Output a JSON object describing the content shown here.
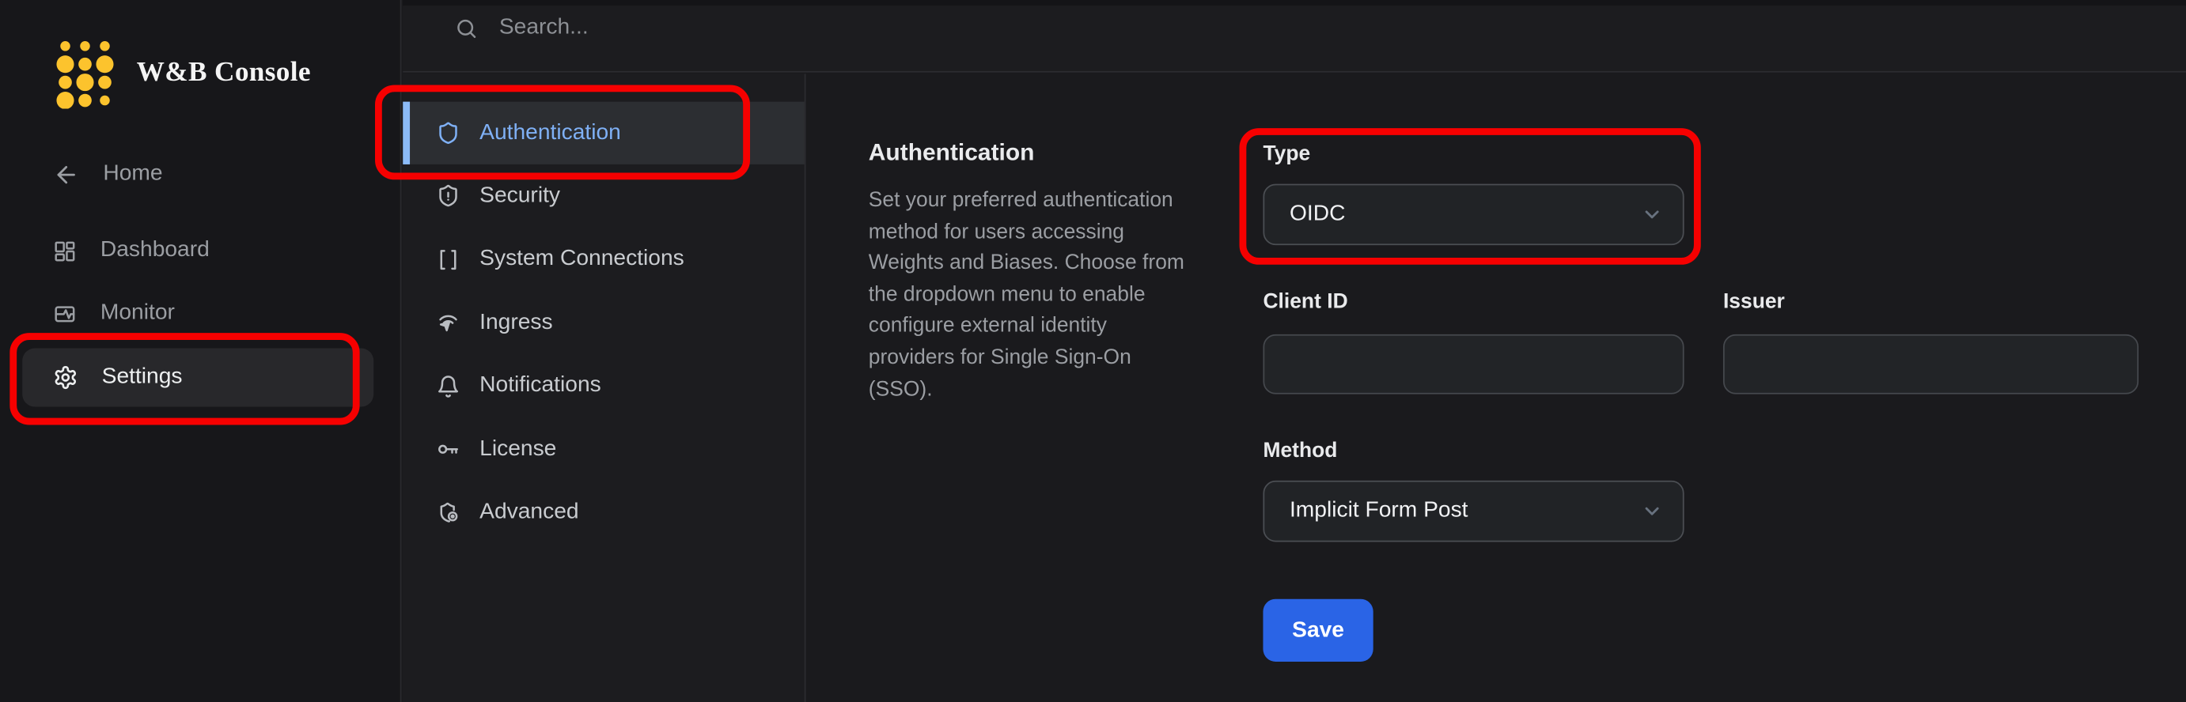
{
  "app": {
    "title": "W&B Console"
  },
  "search": {
    "placeholder": "Search..."
  },
  "left_sidebar": {
    "items": [
      {
        "label": "Home",
        "icon": "arrow-left-icon"
      },
      {
        "label": "Dashboard",
        "icon": "dashboard-icon"
      },
      {
        "label": "Monitor",
        "icon": "monitor-icon"
      },
      {
        "label": "Settings",
        "icon": "gear-icon",
        "active": true
      }
    ]
  },
  "settings_nav": {
    "items": [
      {
        "label": "Authentication",
        "icon": "shield-icon",
        "active": true
      },
      {
        "label": "Security",
        "icon": "shield-alert-icon",
        "active": false
      },
      {
        "label": "System Connections",
        "icon": "brackets-icon",
        "active": false
      },
      {
        "label": "Ingress",
        "icon": "ingress-icon",
        "active": false
      },
      {
        "label": "Notifications",
        "icon": "bell-icon",
        "active": false
      },
      {
        "label": "License",
        "icon": "key-icon",
        "active": false
      },
      {
        "label": "Advanced",
        "icon": "shield-gear-icon",
        "active": false
      }
    ]
  },
  "main": {
    "heading": "Authentication",
    "description": "Set your preferred authentication method for users accessing Weights and Biases. Choose from the dropdown menu to enable configure external identity providers for Single Sign-On (SSO).",
    "form": {
      "type_label": "Type",
      "type_value": "OIDC",
      "client_id_label": "Client ID",
      "client_id_value": "",
      "issuer_label": "Issuer",
      "issuer_value": "",
      "method_label": "Method",
      "method_value": "Implicit Form Post",
      "save_label": "Save"
    }
  },
  "colors": {
    "accent_blue": "#7fb0f5",
    "save_blue": "#2a64e6",
    "annotation_red": "#f60000",
    "brand_yellow": "#fcc32d"
  }
}
